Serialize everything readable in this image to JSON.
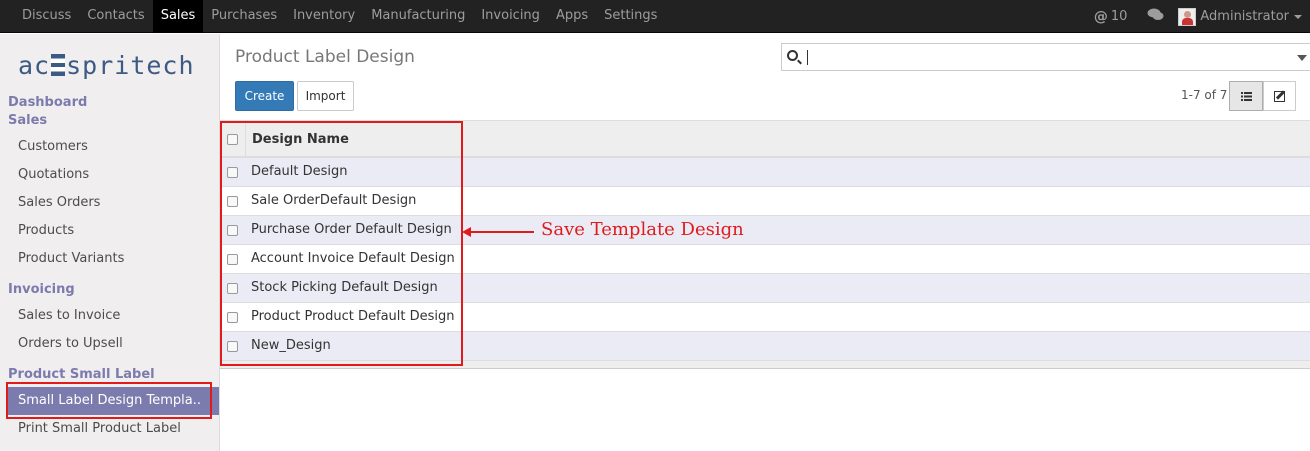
{
  "navbar": {
    "menu": [
      "Discuss",
      "Contacts",
      "Sales",
      "Purchases",
      "Inventory",
      "Manufacturing",
      "Invoicing",
      "Apps",
      "Settings"
    ],
    "active": "Sales",
    "mentions_count": "10",
    "user_name": "Administrator"
  },
  "sidebar": {
    "logo_left": "ac",
    "logo_right": "spritech",
    "section_dashboard": "Dashboard",
    "section_sales": "Sales",
    "sales_items": [
      "Customers",
      "Quotations",
      "Sales Orders",
      "Products",
      "Product Variants"
    ],
    "section_invoicing": "Invoicing",
    "invoicing_items": [
      "Sales to Invoice",
      "Orders to Upsell"
    ],
    "section_label": "Product Small Label",
    "label_items": [
      "Small Label Design Templa..",
      "Print Small Product Label"
    ]
  },
  "main": {
    "title": "Product Label Design",
    "create_label": "Create",
    "import_label": "Import",
    "pager": "1-7 of 7",
    "column_header": "Design Name",
    "rows": [
      "Default Design",
      "Sale OrderDefault Design",
      "Purchase Order Default Design",
      "Account Invoice Default Design",
      "Stock Picking Default Design",
      "Product Product Default Design",
      "New_Design"
    ]
  },
  "annotation": {
    "text": "Save Template Design",
    "color": "#e01b1b"
  },
  "colors": {
    "navbar_bg": "#222222",
    "accent": "#7c7bad",
    "primary_button": "#337ab7"
  }
}
